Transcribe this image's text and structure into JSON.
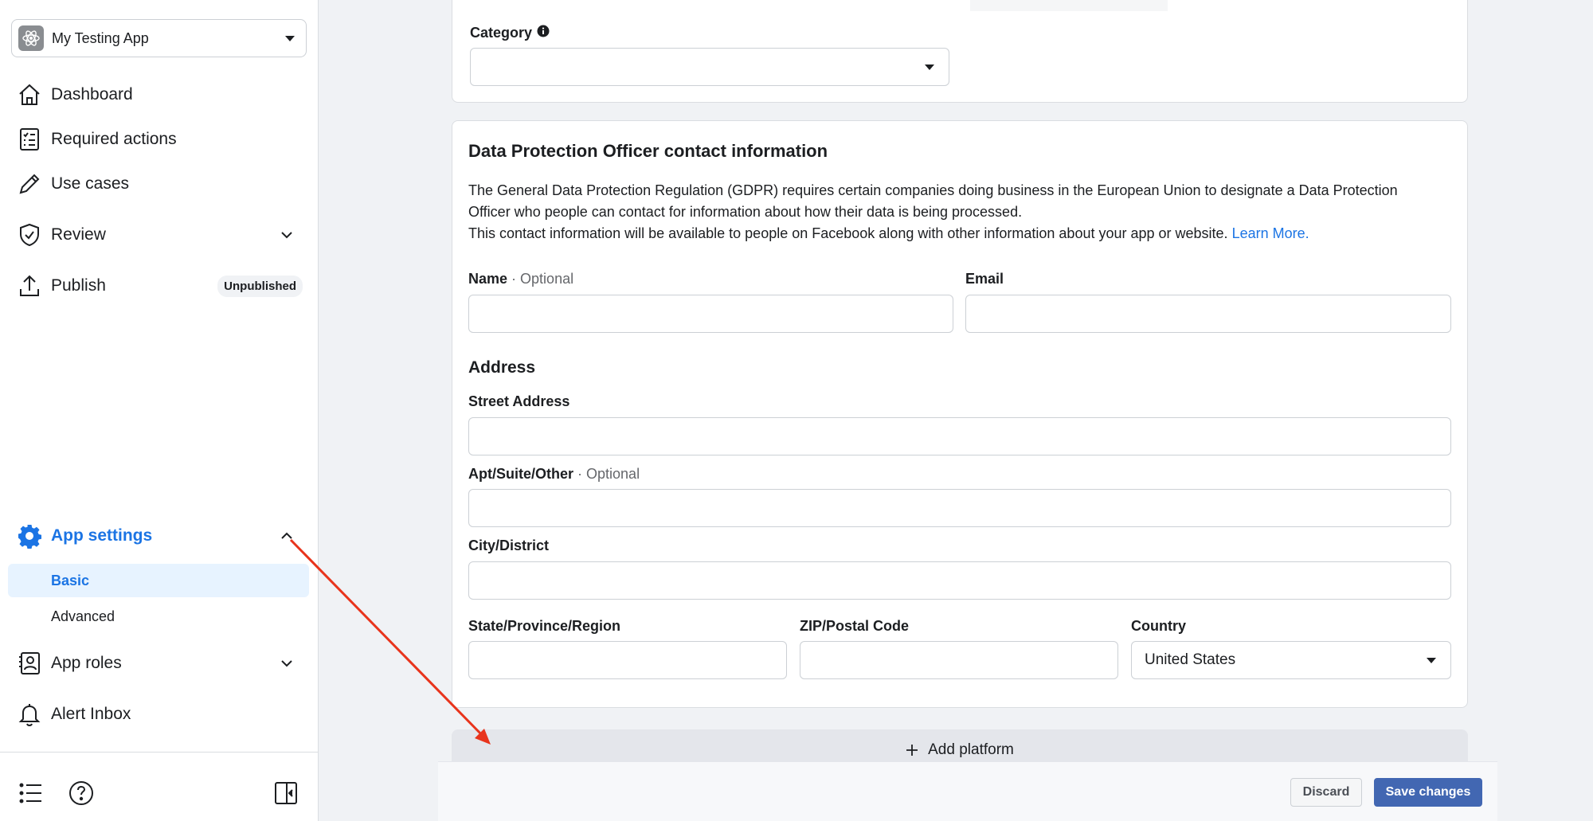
{
  "sidebar": {
    "app_name": "My Testing App",
    "items": [
      {
        "label": "Dashboard"
      },
      {
        "label": "Required actions"
      },
      {
        "label": "Use cases"
      },
      {
        "label": "Review"
      },
      {
        "label": "Publish",
        "badge": "Unpublished"
      },
      {
        "label": "App settings"
      },
      {
        "label": "App roles"
      },
      {
        "label": "Alert Inbox"
      }
    ],
    "subitems": [
      {
        "label": "Basic"
      },
      {
        "label": "Advanced"
      }
    ]
  },
  "category": {
    "label": "Category",
    "value": ""
  },
  "dpo": {
    "title": "Data Protection Officer contact information",
    "desc_line1": "The General Data Protection Regulation (GDPR) requires certain companies doing business in the European Union to designate a Data Protection",
    "desc_line2": "Officer who people can contact for information about how their data is being processed.",
    "desc_line3": "This contact information will be available to people on Facebook along with other information about your app or website.",
    "learn_more": "Learn More.",
    "name_label": "Name",
    "optional": "· Optional",
    "email_label": "Email",
    "address_heading": "Address",
    "street_label": "Street Address",
    "apt_label": "Apt/Suite/Other",
    "city_label": "City/District",
    "state_label": "State/Province/Region",
    "zip_label": "ZIP/Postal Code",
    "country_label": "Country",
    "country_value": "United States"
  },
  "actions": {
    "add_platform": "Add platform",
    "discard": "Discard",
    "save": "Save changes"
  },
  "colors": {
    "accent": "#1b74e4",
    "save_button": "#4267b2",
    "annotation_arrow": "#e8341c"
  }
}
